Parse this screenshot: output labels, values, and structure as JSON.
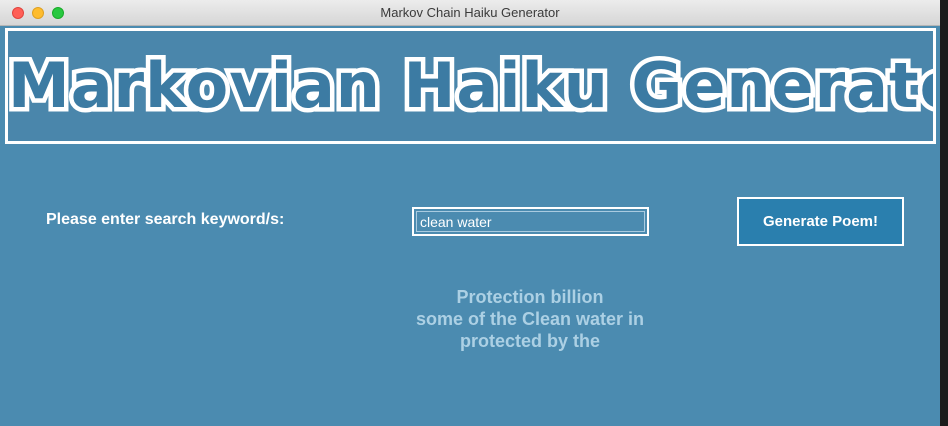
{
  "window": {
    "title": "Markov Chain Haiku Generator"
  },
  "banner": {
    "title": "Markovian Haiku Generator"
  },
  "search": {
    "label": "Please enter search keyword/s:",
    "value": "clean water"
  },
  "generate_button": {
    "label": "Generate Poem!"
  },
  "poem": {
    "lines": [
      "Protection billion",
      "some of the Clean water in",
      "protected by the"
    ]
  },
  "colors": {
    "background": "#4b8bb0",
    "banner_text_fill": "#3c7ba3",
    "button_background": "#2a7fae",
    "poem_text": "#acd0e4"
  }
}
